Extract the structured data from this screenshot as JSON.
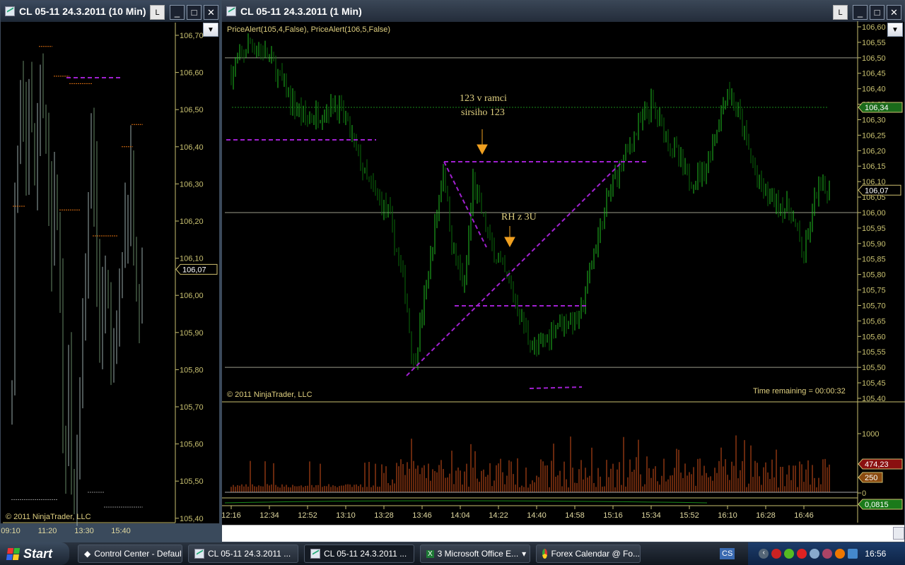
{
  "left_window": {
    "title": "CL 05-11  24.3.2011 (10 Min)",
    "layout_button": "L",
    "price_labels": [
      "106,70",
      "106,60",
      "106,50",
      "106,40",
      "106,30",
      "106,20",
      "106,10",
      "106,00",
      "105,90",
      "105,80",
      "105,70",
      "105,60",
      "105,50",
      "105,40"
    ],
    "price_range": [
      105.4,
      106.7
    ],
    "last_price_tag": "106,07",
    "time_labels": [
      "09:10",
      "11:20",
      "13:30",
      "15:40"
    ],
    "copyright": "© 2011 NinjaTrader, LLC"
  },
  "right_window": {
    "title": "CL 05-11  24.3.2011 (1 Min)",
    "layout_button": "L",
    "indicator_label": "PriceAlert(105,4,False), PriceAlert(106,5,False)",
    "price_labels": [
      "106,60",
      "106,55",
      "106,50",
      "106,45",
      "106,40",
      "106,35",
      "106,30",
      "106,25",
      "106,20",
      "106,15",
      "106,10",
      "106,05",
      "106,00",
      "105,95",
      "105,90",
      "105,85",
      "105,80",
      "105,75",
      "105,70",
      "105,65",
      "105,60",
      "105,55",
      "105,50",
      "105,45",
      "105,40"
    ],
    "price_range": [
      105.4,
      106.6
    ],
    "alert_tag": "106,34",
    "last_price_tag": "106,07",
    "annotations": [
      "123 v ramci",
      "sirsiho 123",
      "RH z 3U"
    ],
    "copyright": "© 2011 NinjaTrader, LLC",
    "time_remaining": "Time remaining = 00:00:32",
    "volume_labels": [
      "1000",
      "0"
    ],
    "volume_ma_tag": "474,23",
    "volume_level_tag": "250",
    "indicator_tag": "0,0815",
    "time_labels": [
      "12:16",
      "12:34",
      "12:52",
      "13:10",
      "13:28",
      "13:46",
      "14:04",
      "14:22",
      "14:40",
      "14:58",
      "15:16",
      "15:34",
      "15:52",
      "16:10",
      "16:28",
      "16:46"
    ],
    "price_path_minutes": [
      0,
      9,
      18,
      29,
      36,
      49,
      54,
      64,
      74,
      82,
      86,
      94,
      100,
      104,
      110,
      114,
      122,
      132,
      140,
      144,
      154,
      164,
      172,
      180,
      190,
      198,
      209,
      216,
      224,
      234,
      240,
      248,
      254,
      264,
      270,
      276
    ],
    "price_path_values": [
      106.45,
      106.55,
      106.5,
      106.35,
      106.3,
      106.35,
      106.3,
      106.1,
      106.0,
      105.75,
      105.5,
      105.85,
      106.15,
      105.9,
      105.75,
      106.1,
      105.9,
      105.75,
      105.6,
      105.55,
      105.65,
      105.65,
      105.9,
      106.1,
      106.25,
      106.35,
      106.2,
      106.1,
      106.15,
      106.4,
      106.3,
      106.1,
      106.05,
      106.0,
      105.85,
      106.07
    ]
  },
  "colors": {
    "up": "#20c020",
    "down": "#0a6a0a",
    "drawing": "#a020d0",
    "alert": "#1a8a1a",
    "axis": "#c8c070",
    "volume": "#d0501a"
  },
  "taskbar": {
    "start": "Start",
    "items": [
      "Control Center - Default",
      "CL 05-11  24.3.2011 ...",
      "CL 05-11  24.3.2011 ...",
      "3 Microsoft Office E...",
      "Forex Calendar @ Fo..."
    ],
    "tray_cs": "CS",
    "clock": "16:56"
  }
}
